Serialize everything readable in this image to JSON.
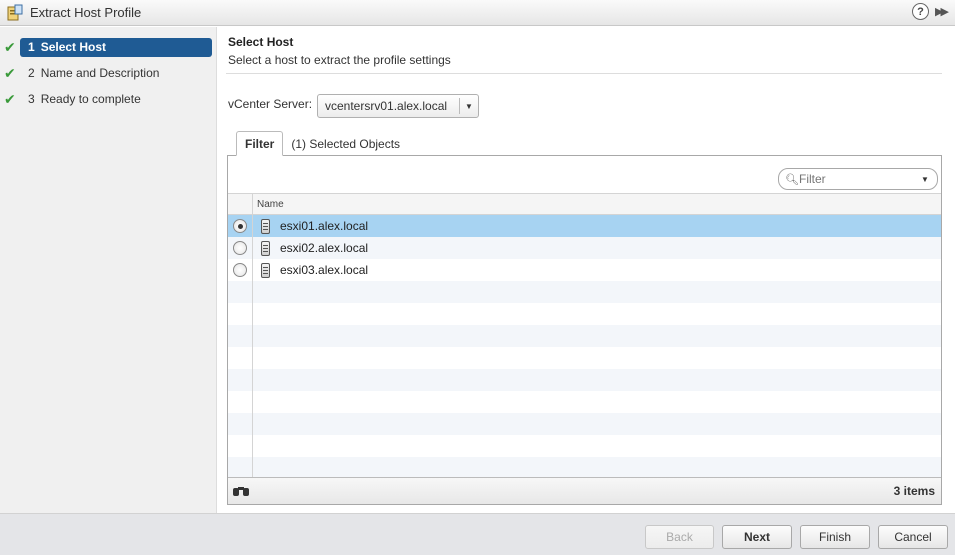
{
  "window": {
    "title": "Extract Host Profile",
    "help_icon": "?",
    "expand_icon": "▶▶"
  },
  "steps": [
    {
      "num": "1",
      "label": "Select Host",
      "done": true,
      "active": true
    },
    {
      "num": "2",
      "label": "Name and Description",
      "done": true,
      "active": false
    },
    {
      "num": "3",
      "label": "Ready to complete",
      "done": true,
      "active": false
    }
  ],
  "page": {
    "title": "Select Host",
    "description": "Select a host to extract the profile settings"
  },
  "vcenter": {
    "label": "vCenter Server:",
    "value": "vcentersrv01.alex.local"
  },
  "tabs": [
    {
      "label": "Filter",
      "active": true
    },
    {
      "label": "(1) Selected Objects",
      "active": false
    }
  ],
  "filter": {
    "placeholder": "Filter"
  },
  "grid": {
    "column_name": "Name",
    "rows": [
      {
        "name": "esxi01.alex.local",
        "selected": true
      },
      {
        "name": "esxi02.alex.local",
        "selected": false
      },
      {
        "name": "esxi03.alex.local",
        "selected": false
      }
    ],
    "count_text": "3 items"
  },
  "buttons": {
    "back": "Back",
    "next": "Next",
    "finish": "Finish",
    "cancel": "Cancel"
  }
}
